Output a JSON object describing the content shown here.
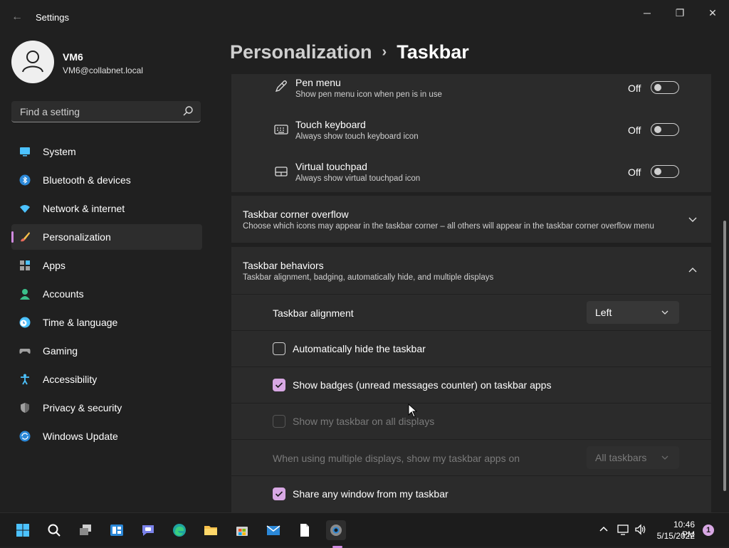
{
  "window": {
    "title": "Settings",
    "minimize_glyph": "─",
    "maximize_glyph": "❐",
    "close_glyph": "✕"
  },
  "user": {
    "name": "VM6",
    "email": "VM6@collabnet.local"
  },
  "search": {
    "placeholder": "Find a setting"
  },
  "sidebar": {
    "items": [
      {
        "label": "System",
        "icon": "system-icon"
      },
      {
        "label": "Bluetooth & devices",
        "icon": "bluetooth-icon"
      },
      {
        "label": "Network & internet",
        "icon": "wifi-icon"
      },
      {
        "label": "Personalization",
        "icon": "brush-icon",
        "active": true
      },
      {
        "label": "Apps",
        "icon": "apps-icon"
      },
      {
        "label": "Accounts",
        "icon": "person-icon"
      },
      {
        "label": "Time & language",
        "icon": "clock-globe-icon"
      },
      {
        "label": "Gaming",
        "icon": "controller-icon"
      },
      {
        "label": "Accessibility",
        "icon": "accessibility-icon"
      },
      {
        "label": "Privacy & security",
        "icon": "shield-icon"
      },
      {
        "label": "Windows Update",
        "icon": "update-icon"
      }
    ]
  },
  "breadcrumb": {
    "parent": "Personalization",
    "separator": "›",
    "current": "Taskbar"
  },
  "system_tray_icons": {
    "pen_menu": {
      "title": "Pen menu",
      "subtitle": "Show pen menu icon when pen is in use",
      "state": "Off"
    },
    "touch_keyboard": {
      "title": "Touch keyboard",
      "subtitle": "Always show touch keyboard icon",
      "state": "Off"
    },
    "virtual_touchpad": {
      "title": "Virtual touchpad",
      "subtitle": "Always show virtual touchpad icon",
      "state": "Off"
    }
  },
  "corner_overflow": {
    "title": "Taskbar corner overflow",
    "subtitle": "Choose which icons may appear in the taskbar corner – all others will appear in the taskbar corner overflow menu"
  },
  "behaviors": {
    "title": "Taskbar behaviors",
    "subtitle": "Taskbar alignment, badging, automatically hide, and multiple displays",
    "alignment_label": "Taskbar alignment",
    "alignment_value": "Left",
    "auto_hide_label": "Automatically hide the taskbar",
    "auto_hide_checked": false,
    "badges_label": "Show badges (unread messages counter) on taskbar apps",
    "badges_checked": true,
    "all_displays_label": "Show my taskbar on all displays",
    "all_displays_checked": false,
    "multi_display_label": "When using multiple displays, show my taskbar apps on",
    "multi_display_value": "All taskbars",
    "share_window_label": "Share any window from my taskbar",
    "share_window_checked": true
  },
  "taskbar": {
    "apps": [
      "start-icon",
      "search-icon",
      "task-view-icon",
      "widgets-icon",
      "teams-chat-icon",
      "edge-icon",
      "file-explorer-icon",
      "store-icon",
      "mail-icon",
      "notepad-icon",
      "settings-icon"
    ],
    "time": "10:46 PM",
    "date": "5/15/2022",
    "notification_count": "1"
  },
  "colors": {
    "accent": "#d08ae0",
    "accent_light": "#d8a8e4",
    "background": "#202020",
    "card": "#2b2b2b"
  }
}
